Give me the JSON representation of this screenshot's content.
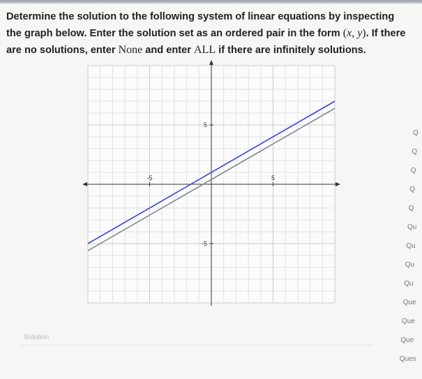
{
  "problem": {
    "part1": "Determine the solution to the following system of linear equations by inspecting the graph below. Enter the solution set as an ordered pair in the form ",
    "math_open": "(",
    "math_x": "x",
    "math_comma": ", ",
    "math_y": "y",
    "math_close": ")",
    "part2": ". If there are no solutions, enter ",
    "none_word": "None",
    "part3": " and enter ",
    "all_word": "ALL",
    "part4": " if there are infinitely solutions."
  },
  "chart_data": {
    "type": "line",
    "xlim": [
      -10,
      10
    ],
    "ylim": [
      -10,
      10
    ],
    "grid": true,
    "tick_labels": {
      "x_neg": "-5",
      "x_pos": "5",
      "y_pos": "5",
      "y_neg": "-5"
    },
    "series": [
      {
        "slope": 0.6,
        "intercept": 1.0,
        "color": "#3b46d9"
      },
      {
        "slope": 0.6,
        "intercept": 0.4,
        "color": "#7f858c"
      }
    ]
  },
  "sidebar_nav": [
    "Q",
    "Q",
    "Q",
    "Q",
    "Q",
    "Qu",
    "Qu",
    "Qu",
    "Qu",
    "Que",
    "Que",
    "Que",
    "Ques"
  ],
  "solution": {
    "label": "Solution",
    "value": ""
  }
}
